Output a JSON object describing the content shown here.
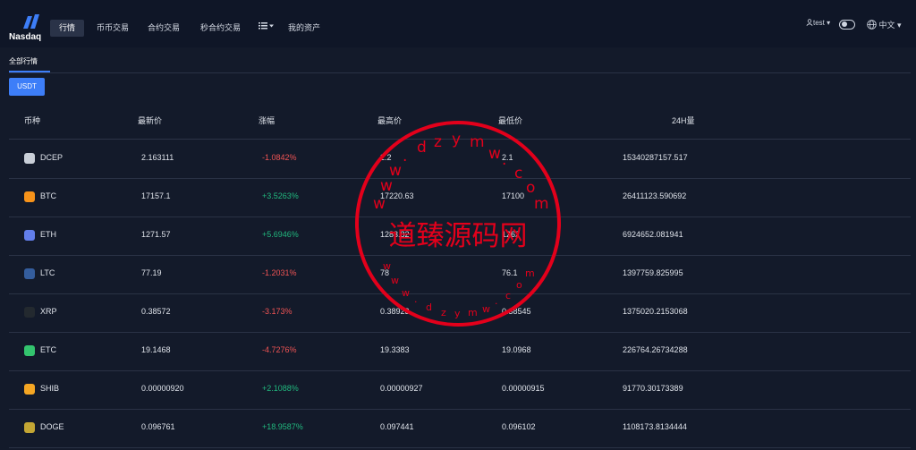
{
  "header": {
    "logo_text": "Nasdaq",
    "nav": [
      "行情",
      "币币交易",
      "合约交易",
      "秒合约交易",
      "我的资产"
    ],
    "more_menu": "menu",
    "user": "test",
    "language": "中文"
  },
  "tabs": [
    "全部行情"
  ],
  "filter_button": "USDT",
  "table": {
    "columns": [
      "币种",
      "最新价",
      "涨幅",
      "最高价",
      "最低价",
      "24H量"
    ],
    "rows": [
      {
        "coin": "DCEP",
        "price": "2.163111",
        "change": "-1.0842%",
        "direction": "down",
        "high": "2.2",
        "low": "2.1",
        "volume": "15340287157.517",
        "icon_color": "#c9cfd8"
      },
      {
        "coin": "BTC",
        "price": "17157.1",
        "change": "+3.5263%",
        "direction": "up",
        "high": "17220.63",
        "low": "17100",
        "volume": "26411123.590692",
        "icon_color": "#f7931a"
      },
      {
        "coin": "ETH",
        "price": "1271.57",
        "change": "+5.6946%",
        "direction": "up",
        "high": "1283.82",
        "low": "1262",
        "volume": "6924652.081941",
        "icon_color": "#627eea"
      },
      {
        "coin": "LTC",
        "price": "77.19",
        "change": "-1.2031%",
        "direction": "down",
        "high": "78",
        "low": "76.1",
        "volume": "1397759.825995",
        "icon_color": "#345d9d"
      },
      {
        "coin": "XRP",
        "price": "0.38572",
        "change": "-3.173%",
        "direction": "down",
        "high": "0.38923",
        "low": "0.38545",
        "volume": "1375020.2153068",
        "icon_color": "#23292f"
      },
      {
        "coin": "ETC",
        "price": "19.1468",
        "change": "-4.7276%",
        "direction": "down",
        "high": "19.3383",
        "low": "19.0968",
        "volume": "226764.26734288",
        "icon_color": "#33c46e"
      },
      {
        "coin": "SHIB",
        "price": "0.00000920",
        "change": "+2.1088%",
        "direction": "up",
        "high": "0.00000927",
        "low": "0.00000915",
        "volume": "91770.30173389",
        "icon_color": "#f5a623"
      },
      {
        "coin": "DOGE",
        "price": "0.096761",
        "change": "+18.9587%",
        "direction": "up",
        "high": "0.097441",
        "low": "0.096102",
        "volume": "1108173.8134444",
        "icon_color": "#c3a634"
      }
    ]
  },
  "watermark": {
    "text": "道臻源码网",
    "url_text": "www.dzym.com",
    "color": "#e3001b"
  },
  "colors": {
    "up": "#21b87e",
    "down": "#f05454",
    "accent": "#3d7ef8",
    "background": "#131a2a"
  }
}
